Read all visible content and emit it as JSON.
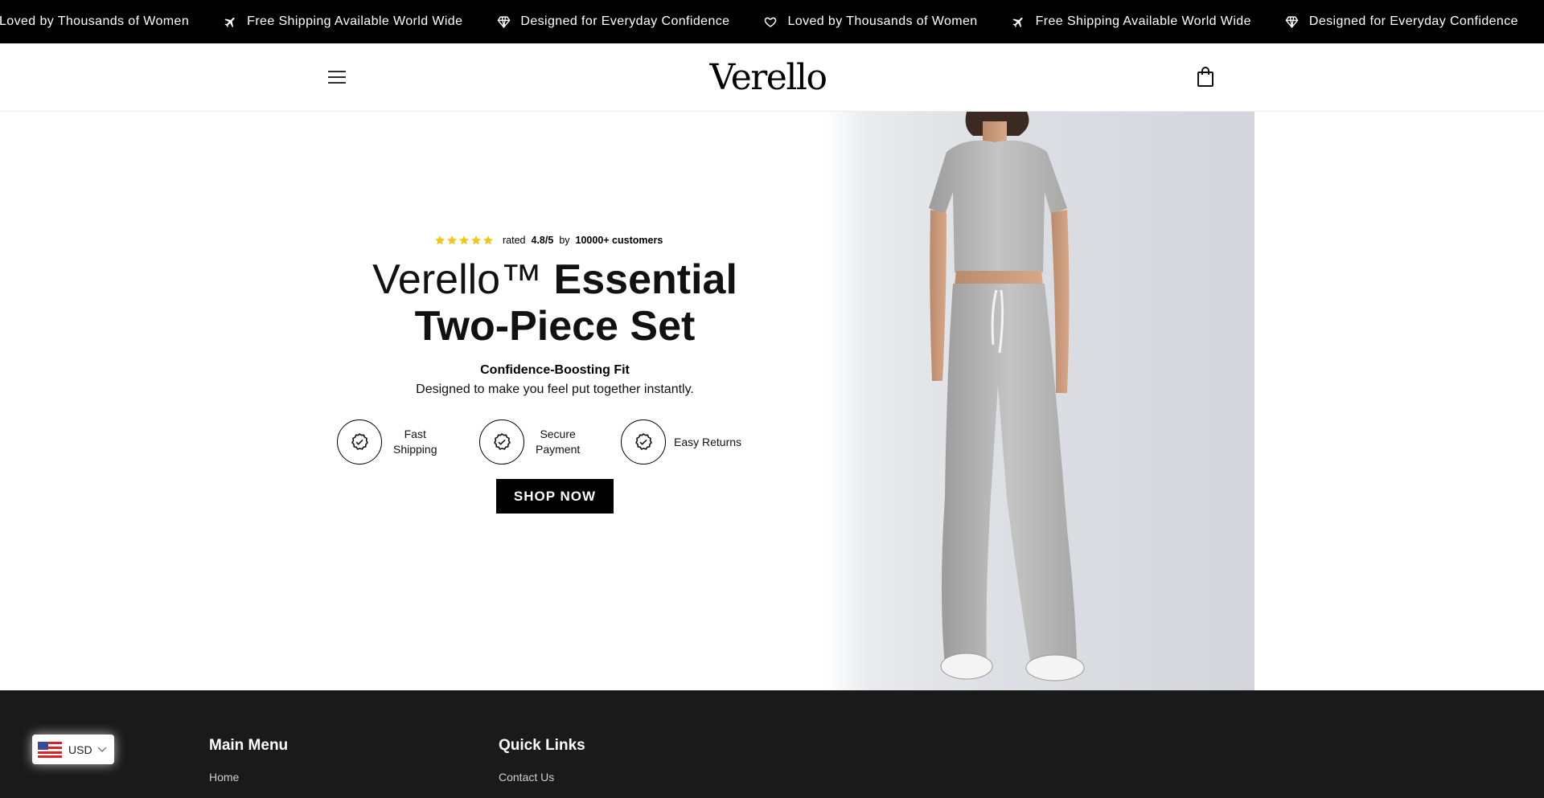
{
  "announcement": {
    "items": [
      {
        "icon": "heart-icon",
        "text": "Loved by Thousands of Women"
      },
      {
        "icon": "airplane-icon",
        "text": "Free Shipping Available World Wide"
      },
      {
        "icon": "diamond-icon",
        "text": "Designed for Everyday Confidence"
      },
      {
        "icon": "heart-icon",
        "text": "Loved by Thousands of Women"
      },
      {
        "icon": "airplane-icon",
        "text": "Free Shipping Available World Wide"
      },
      {
        "icon": "diamond-icon",
        "text": "Designed for Everyday Confidence"
      }
    ]
  },
  "header": {
    "logo": "Verello",
    "menu_icon": "hamburger-icon",
    "cart_icon": "shopping-bag-icon"
  },
  "hero": {
    "rating": {
      "stars": 5,
      "prefix": "rated",
      "score": "4.8/5",
      "by": "by",
      "customers": "10000+ customers",
      "star_color": "#f5c518"
    },
    "title_light": "Verello™",
    "title_bold_1": "Essential",
    "title_bold_2": "Two-Piece Set",
    "subtitle": "Confidence-Boosting Fit",
    "description": "Designed to make you feel put together instantly.",
    "features": [
      {
        "icon": "badge-check-icon",
        "line1": "Fast",
        "line2": "Shipping"
      },
      {
        "icon": "badge-check-icon",
        "line1": "Secure",
        "line2": "Payment"
      },
      {
        "icon": "badge-check-icon",
        "line1": "Easy Returns",
        "line2": ""
      }
    ],
    "cta": "SHOP NOW"
  },
  "footer": {
    "main_menu": {
      "heading": "Main Menu",
      "links": [
        "Home"
      ]
    },
    "quick_links": {
      "heading": "Quick Links",
      "links": [
        "Contact Us"
      ]
    },
    "currency": {
      "code": "USD",
      "flag_icon": "us-flag-icon"
    }
  },
  "colors": {
    "announcement_bg": "#000000",
    "footer_bg": "#1a1a1a",
    "cta_bg": "#000000",
    "star": "#f5c518"
  }
}
